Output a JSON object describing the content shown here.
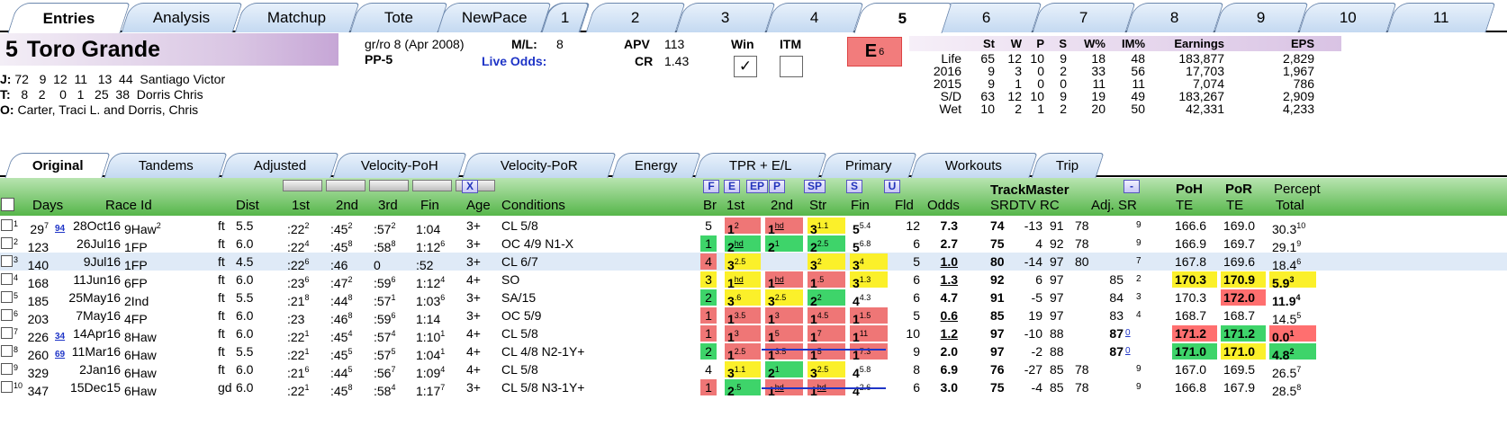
{
  "top_tabs": [
    "Entries",
    "Analysis",
    "Matchup",
    "Tote",
    "NewPace",
    "1",
    "2",
    "3",
    "4",
    "5",
    "6",
    "7",
    "8",
    "9",
    "10",
    "11"
  ],
  "horse": {
    "number": "5",
    "name": "Toro Grande"
  },
  "jockey": {
    "label": "J:",
    "stats": "72   9  12  11   13  44",
    "name": "Santiago Victor"
  },
  "trainer": {
    "label": "T:",
    "stats": "  8   2    0   1   25  38",
    "name": "Dorris Chris"
  },
  "owner": {
    "label": "O:",
    "name": "Carter, Traci L. and Dorris, Chris"
  },
  "breeding": "gr/ro 8 (Apr 2008)",
  "ml_label": "M/L:",
  "ml_value": "8",
  "pp": "PP-5",
  "live_odds": "Live Odds:",
  "apv_label": "APV",
  "apv": "113",
  "cr_label": "CR",
  "cr": "1.43",
  "win_label": "Win",
  "itm_label": "ITM",
  "win_check": "✓",
  "e_rating": "E",
  "e_sup": "6",
  "stats_head": [
    "St",
    "W",
    "P",
    "S",
    "W%",
    "IM%",
    "Earnings",
    "EPS"
  ],
  "stats_rows": [
    [
      "Life",
      "65",
      "12",
      "10",
      "9",
      "18",
      "48",
      "183,877",
      "2,829"
    ],
    [
      "2016",
      "9",
      "3",
      "0",
      "2",
      "33",
      "56",
      "17,703",
      "1,967"
    ],
    [
      "2015",
      "9",
      "1",
      "0",
      "0",
      "11",
      "11",
      "7,074",
      "786"
    ],
    [
      "S/D",
      "63",
      "12",
      "10",
      "9",
      "19",
      "49",
      "183,267",
      "2,909"
    ],
    [
      "Wet",
      "10",
      "2",
      "1",
      "2",
      "20",
      "50",
      "42,331",
      "4,233"
    ]
  ],
  "sub_tabs": [
    "Original",
    "Tandems",
    "Adjusted",
    "Velocity-PoH",
    "Velocity-PoR",
    "Energy",
    "TPR + E/L",
    "Primary",
    "Workouts",
    "Trip"
  ],
  "header_btns": [
    "X",
    "F",
    "E",
    "EP",
    "P",
    "SP",
    "S",
    "U",
    "-"
  ],
  "headers": {
    "days": "Days",
    "raceid": "Race Id",
    "dist": "Dist",
    "f1": "1st",
    "f2": "2nd",
    "f3": "3rd",
    "fin": "Fin",
    "age": "Age",
    "cond": "Conditions",
    "br": "Br",
    "c1": "1st",
    "c2": "2nd",
    "str": "Str",
    "cfin": "Fin",
    "fld": "Fld",
    "odds": "Odds",
    "tm": "TrackMaster",
    "tmsub": "SRDTV RC",
    "adj": "Adj. SR",
    "poh": "PoH",
    "por": "PoR",
    "te1": "TE",
    "te2": "TE",
    "pct": "Percept",
    "tot": "Total"
  },
  "rows": [
    {
      "n": "1",
      "days": "29",
      "dsup": "7",
      "sub": "94",
      "date": "28Oct16",
      "race": "9Haw",
      "rsup": "2",
      "surf": "ft",
      "dist": "5.5",
      "f1": ":22",
      "f1s": "2",
      "f2": ":45",
      "f2s": "2",
      "f3": ":57",
      "f3s": "2",
      "fin": "1:04",
      "fins": "",
      "age": "3+",
      "cond": "CL 5/8",
      "br": "5",
      "c1": "1",
      "c1s": "2",
      "c2": "1",
      "c2s": "hd",
      "cs": "3",
      "css": "1.1",
      "cf": "5",
      "cfs": "5.4",
      "fld": "12",
      "odds": "7.3",
      "sr": "74",
      "dtv": "-13",
      "rc": "91",
      "adj": "78",
      "adjn": "9",
      "poh": "166.6",
      "por": "169.0",
      "pct": "30.3",
      "pcts": "10"
    },
    {
      "n": "2",
      "days": "123",
      "dsup": "",
      "sub": "",
      "date": "26Jul16",
      "race": "1FP",
      "rsup": "",
      "surf": "ft",
      "dist": "6.0",
      "f1": ":22",
      "f1s": "4",
      "f2": ":45",
      "f2s": "8",
      "f3": ":58",
      "f3s": "8",
      "fin": "1:12",
      "fins": "6",
      "age": "3+",
      "cond": "OC 4/9 N1-X",
      "br": "1",
      "c1": "2",
      "c1s": "hd",
      "c2": "2",
      "c2s": "1",
      "cs": "2",
      "css": "2.5",
      "cf": "5",
      "cfs": "6.8",
      "fld": "6",
      "odds": "2.7",
      "sr": "75",
      "dtv": "4",
      "rc": "92",
      "adj": "78",
      "adjn": "9",
      "poh": "166.9",
      "por": "169.7",
      "pct": "29.1",
      "pcts": "9"
    },
    {
      "n": "3",
      "days": "140",
      "dsup": "",
      "sub": "",
      "date": "9Jul16",
      "race": "1FP",
      "rsup": "",
      "surf": "ft",
      "dist": "4.5",
      "f1": ":22",
      "f1s": "6",
      "f2": ":46",
      "f2s": "",
      "f3": "0",
      "f3s": "",
      "fin": ":52",
      "fins": "",
      "age": "3+",
      "cond": "CL 6/7",
      "br": "4",
      "c1": "3",
      "c1s": "2.5",
      "c2": "",
      "c2s": "",
      "cs": "3",
      "css": "2",
      "cf": "3",
      "cfs": "4",
      "fld": "5",
      "odds": "1.0",
      "sr": "80",
      "dtv": "-14",
      "rc": "97",
      "adj": "80",
      "adjn": "7",
      "poh": "167.8",
      "por": "169.6",
      "pct": "18.4",
      "pcts": "6"
    },
    {
      "n": "4",
      "days": "168",
      "dsup": "",
      "sub": "",
      "date": "11Jun16",
      "race": "6FP",
      "rsup": "",
      "surf": "ft",
      "dist": "6.0",
      "f1": ":23",
      "f1s": "6",
      "f2": ":47",
      "f2s": "2",
      "f3": ":59",
      "f3s": "6",
      "fin": "1:12",
      "fins": "4",
      "age": "4+",
      "cond": "SO",
      "br": "3",
      "c1": "1",
      "c1s": "hd",
      "c2": "1",
      "c2s": "hd",
      "cs": "1",
      "css": ".5",
      "cf": "3",
      "cfs": "1.3",
      "fld": "6",
      "odds": "1.3",
      "sr": "92",
      "dtv": "6",
      "rc": "97",
      "adj": "85",
      "adjn": "2",
      "poh": "170.3",
      "por": "170.9",
      "pct": "5.9",
      "pcts": "3"
    },
    {
      "n": "5",
      "days": "185",
      "dsup": "",
      "sub": "",
      "date": "25May16",
      "race": "2Ind",
      "rsup": "",
      "surf": "ft",
      "dist": "5.5",
      "f1": ":21",
      "f1s": "8",
      "f2": ":44",
      "f2s": "8",
      "f3": ":57",
      "f3s": "1",
      "fin": "1:03",
      "fins": "6",
      "age": "3+",
      "cond": "SA/15",
      "br": "2",
      "c1": "3",
      "c1s": ".6",
      "c2": "3",
      "c2s": "2.5",
      "cs": "2",
      "css": "2",
      "cf": "4",
      "cfs": "4.3",
      "fld": "6",
      "odds": "4.7",
      "sr": "91",
      "dtv": "-5",
      "rc": "97",
      "adj": "84",
      "adjn": "3",
      "poh": "170.3",
      "por": "172.0",
      "pct": "11.9",
      "pcts": "4"
    },
    {
      "n": "6",
      "days": "203",
      "dsup": "",
      "sub": "",
      "date": "7May16",
      "race": "4FP",
      "rsup": "",
      "surf": "ft",
      "dist": "6.0",
      "f1": ":23",
      "f1s": "",
      "f2": ":46",
      "f2s": "8",
      "f3": ":59",
      "f3s": "6",
      "fin": "1:14",
      "fins": "",
      "age": "3+",
      "cond": "OC 5/9",
      "br": "1",
      "c1": "1",
      "c1s": "3.5",
      "c2": "1",
      "c2s": "3",
      "cs": "1",
      "css": "4.5",
      "cf": "1",
      "cfs": "1.5",
      "fld": "5",
      "odds": "0.6",
      "sr": "85",
      "dtv": "19",
      "rc": "97",
      "adj": "83",
      "adjn": "4",
      "poh": "168.7",
      "por": "168.7",
      "pct": "14.5",
      "pcts": "5"
    },
    {
      "n": "7",
      "days": "226",
      "dsup": "",
      "sub": "34",
      "date": "14Apr16",
      "race": "8Haw",
      "rsup": "",
      "surf": "ft",
      "dist": "6.0",
      "f1": ":22",
      "f1s": "1",
      "f2": ":45",
      "f2s": "4",
      "f3": ":57",
      "f3s": "4",
      "fin": "1:10",
      "fins": "1",
      "age": "4+",
      "cond": "CL 5/8",
      "br": "1",
      "c1": "1",
      "c1s": "3",
      "c2": "1",
      "c2s": "5",
      "cs": "1",
      "css": "7",
      "cf": "1",
      "cfs": "11",
      "fld": "10",
      "odds": "1.2",
      "sr": "97",
      "dtv": "-10",
      "rc": "88",
      "adj": "87",
      "adjn": "0",
      "poh": "171.2",
      "por": "171.2",
      "pct": "0.0",
      "pcts": "1"
    },
    {
      "n": "8",
      "days": "260",
      "dsup": "",
      "sub": "69",
      "date": "11Mar16",
      "race": "6Haw",
      "rsup": "",
      "surf": "ft",
      "dist": "5.5",
      "f1": ":22",
      "f1s": "1",
      "f2": ":45",
      "f2s": "5",
      "f3": ":57",
      "f3s": "5",
      "fin": "1:04",
      "fins": "1",
      "age": "4+",
      "cond": "CL 4/8 N2-1Y+",
      "br": "2",
      "c1": "1",
      "c1s": "2.5",
      "c2": "1",
      "c2s": "3.5",
      "cs": "1",
      "css": "5",
      "cf": "1",
      "cfs": "7.3",
      "fld": "9",
      "odds": "2.0",
      "sr": "97",
      "dtv": "-2",
      "rc": "88",
      "adj": "87",
      "adjn": "0",
      "poh": "171.0",
      "por": "171.0",
      "pct": "4.8",
      "pcts": "2"
    },
    {
      "n": "9",
      "days": "329",
      "dsup": "",
      "sub": "",
      "date": "2Jan16",
      "race": "6Haw",
      "rsup": "",
      "surf": "ft",
      "dist": "6.0",
      "f1": ":21",
      "f1s": "6",
      "f2": ":44",
      "f2s": "5",
      "f3": ":56",
      "f3s": "7",
      "fin": "1:09",
      "fins": "4",
      "age": "4+",
      "cond": "CL 5/8",
      "br": "4",
      "c1": "3",
      "c1s": "1.1",
      "c2": "2",
      "c2s": "1",
      "cs": "3",
      "css": "2.5",
      "cf": "4",
      "cfs": "5.8",
      "fld": "8",
      "odds": "6.9",
      "sr": "76",
      "dtv": "-27",
      "rc": "85",
      "adj": "78",
      "adjn": "9",
      "poh": "167.0",
      "por": "169.5",
      "pct": "26.5",
      "pcts": "7"
    },
    {
      "n": "10",
      "days": "347",
      "dsup": "",
      "sub": "",
      "date": "15Dec15",
      "race": "6Haw",
      "rsup": "",
      "surf": "gd",
      "dist": "6.0",
      "f1": ":22",
      "f1s": "1",
      "f2": ":45",
      "f2s": "8",
      "f3": ":58",
      "f3s": "4",
      "fin": "1:17",
      "fins": "7",
      "age": "3+",
      "cond": "CL 5/8 N3-1Y+",
      "br": "1",
      "c1": "2",
      "c1s": ".5",
      "c2": "1",
      "c2s": "hd",
      "cs": "1",
      "css": "hd",
      "cf": "4",
      "cfs": "2.6",
      "fld": "6",
      "odds": "3.0",
      "sr": "75",
      "dtv": "-4",
      "rc": "85",
      "adj": "78",
      "adjn": "9",
      "poh": "166.8",
      "por": "167.9",
      "pct": "28.5",
      "pcts": "8"
    }
  ]
}
